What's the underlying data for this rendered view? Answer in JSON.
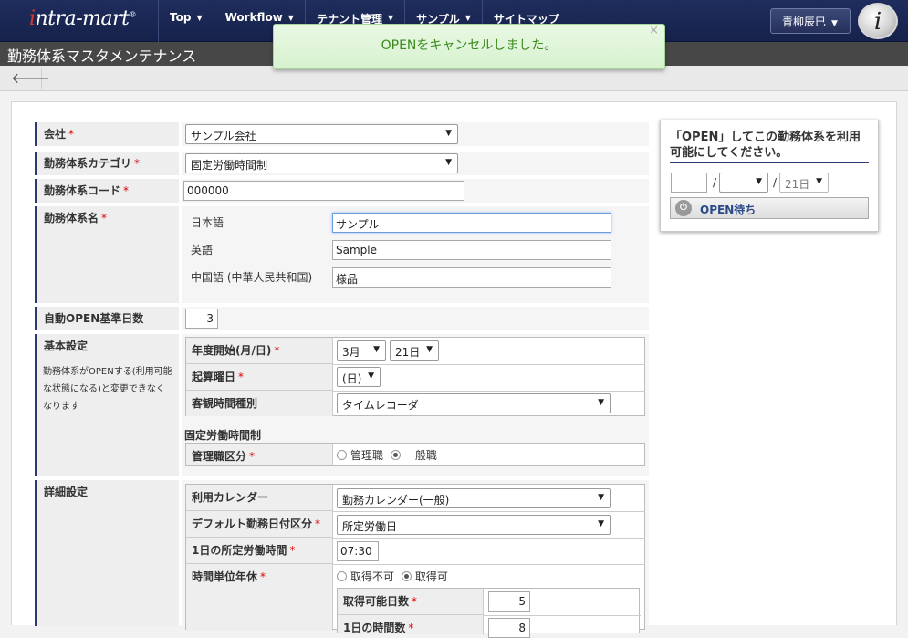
{
  "header": {
    "logo_prefix": "i",
    "logo_rest": "ntra-mart",
    "logo_mark": "®",
    "nav": [
      {
        "label": "Top",
        "caret": true
      },
      {
        "label": "Workflow",
        "caret": true
      },
      {
        "label": "テナント管理",
        "caret": true
      },
      {
        "label": "サンプル",
        "caret": true
      },
      {
        "label": "サイトマップ",
        "caret": false
      }
    ],
    "user": "青柳辰巳",
    "i_logo": "i"
  },
  "page_title": "勤務体系マスタメンテナンス",
  "toast": {
    "message": "OPENをキャンセルしました。",
    "close": "×"
  },
  "form": {
    "company": {
      "label": "会社",
      "value": "サンプル会社"
    },
    "category": {
      "label": "勤務体系カテゴリ",
      "value": "固定労働時間制"
    },
    "code": {
      "label": "勤務体系コード",
      "value": "000000"
    },
    "name": {
      "label": "勤務体系名",
      "langs": [
        {
          "label": "日本語",
          "value": "サンプル"
        },
        {
          "label": "英語",
          "value": "Sample"
        },
        {
          "label": "中国語 (中華人民共和国)",
          "value": "様品"
        }
      ]
    },
    "auto_open": {
      "label": "自動OPEN基準日数",
      "value": "3"
    },
    "basic": {
      "label": "基本設定",
      "note": "勤務体系がOPENする(利用可能な状態になる)と変更できなくなります",
      "fiscal_start": {
        "label": "年度開始(月/日)",
        "month": "3月",
        "day": "21日"
      },
      "start_weekday": {
        "label": "起算曜日",
        "value": "(日)"
      },
      "time_type": {
        "label": "客観時間種別",
        "value": "タイムレコーダ"
      },
      "fixed_heading": "固定労働時間制",
      "manager": {
        "label": "管理職区分",
        "options": [
          "管理職",
          "一般職"
        ],
        "selected": 1
      }
    },
    "detail": {
      "label": "詳細設定",
      "calendar": {
        "label": "利用カレンダー",
        "value": "勤務カレンダー(一般)"
      },
      "default_day": {
        "label": "デフォルト勤務日付区分",
        "value": "所定労働日"
      },
      "daily_hours": {
        "label": "1日の所定労働時間",
        "value": "07:30"
      },
      "hourly_leave": {
        "label": "時間単位年休",
        "options": [
          "取得不可",
          "取得可"
        ],
        "selected": 1,
        "days": {
          "label": "取得可能日数",
          "value": "5"
        },
        "hours": {
          "label": "1日の時間数",
          "value": "8"
        }
      }
    }
  },
  "open_panel": {
    "title": "「OPEN」してこの勤務体系を利用可能にしてください。",
    "sep1": "/",
    "sep2": "/",
    "day": "21日",
    "button": "OPEN待ち"
  }
}
